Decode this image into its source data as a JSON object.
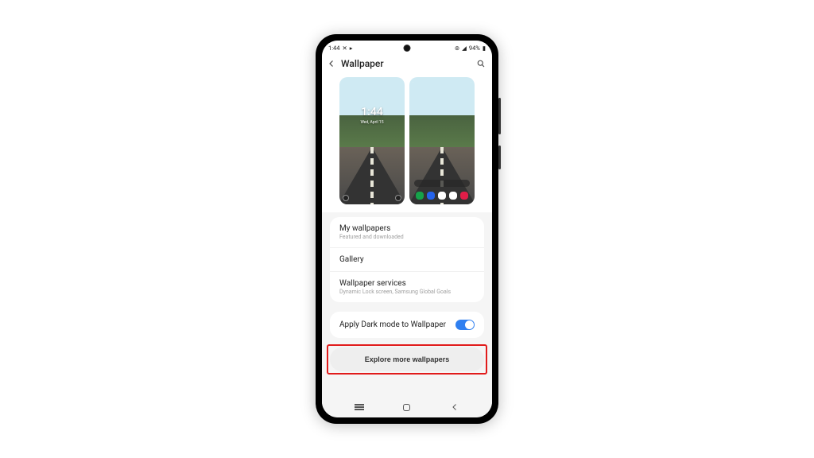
{
  "status": {
    "time": "1:44",
    "battery": "94%",
    "network_icons": "⌁",
    "signal_text": "⟡ ₄"
  },
  "header": {
    "title": "Wallpaper"
  },
  "lockscreen_preview": {
    "time": "1:44",
    "date": "Wed, April 15"
  },
  "menu": {
    "my_wallpapers": {
      "title": "My wallpapers",
      "subtitle": "Featured and downloaded"
    },
    "gallery": {
      "title": "Gallery"
    },
    "services": {
      "title": "Wallpaper services",
      "subtitle": "Dynamic Lock screen, Samsung Global Goals"
    }
  },
  "dark_mode": {
    "label": "Apply Dark mode to Wallpaper",
    "enabled": true
  },
  "explore_button": "Explore more wallpapers",
  "highlight_color": "#e11b1b"
}
